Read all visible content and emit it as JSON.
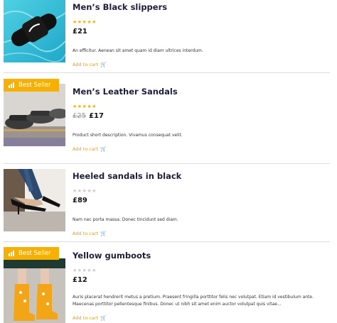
{
  "products": [
    {
      "title": "Men’s Black slippers",
      "rating": 5,
      "stars_filled": "★★★★★",
      "stars_empty": "",
      "old_price": "",
      "price": "£21",
      "description": "An efficitur. Aenean sit amet quam id diam ultrices interdum.",
      "add_to_cart": "Add to cart",
      "badge": ""
    },
    {
      "title": "Men’s Leather Sandals",
      "rating": 5,
      "stars_filled": "★★★★★",
      "stars_empty": "",
      "old_price": "£25",
      "price": "£17",
      "description": "Product short description. Vivamus consequat velit.",
      "add_to_cart": "Add to cart",
      "badge": "Best Seller"
    },
    {
      "title": "Heeled sandals in black",
      "rating": 0,
      "stars_filled": "",
      "stars_empty": "★★★★★",
      "old_price": "",
      "price": "£89",
      "description": "Nam nec porta massa. Donec tincidunt sed diam.",
      "add_to_cart": "Add to cart",
      "badge": ""
    },
    {
      "title": "Yellow gumboots",
      "rating": 0,
      "stars_filled": "",
      "stars_empty": "★★★★★",
      "old_price": "",
      "price": "£12",
      "description": "Auris placerat hendrerit metus a pretium. Praesent fringilla porttitor felis nec volutpat. Etiam id vestibulum ante. Maecenas porttitor pellentesque finibus. Donec ut nibh sit amet enim auctor volutpat quis vitae...",
      "add_to_cart": "Add to cart",
      "badge": "Best Seller"
    }
  ],
  "colors": {
    "accent": "#f6b100",
    "link": "#e89d00",
    "title": "#1d1d3a"
  },
  "icons": {
    "cart": "cart-icon",
    "badge": "bar-chart-icon"
  }
}
